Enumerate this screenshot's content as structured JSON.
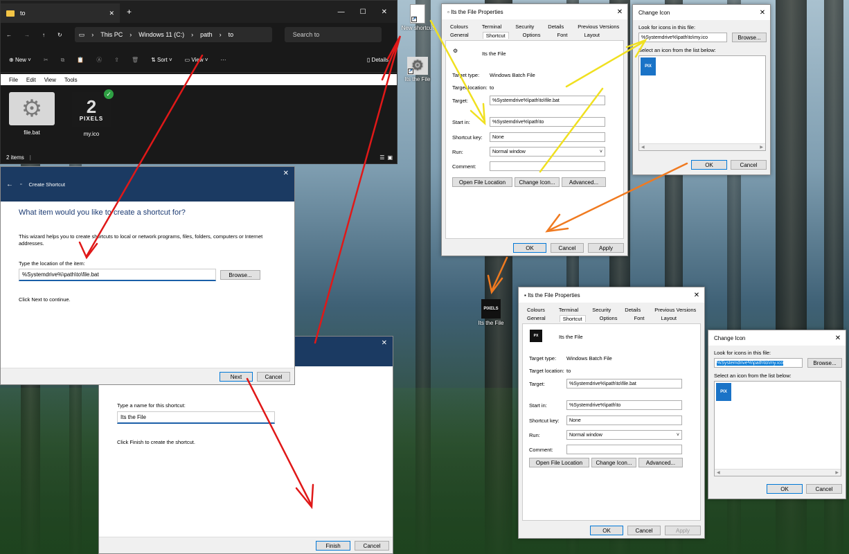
{
  "colors": {
    "red_arrow": "#e01818",
    "yellow_arrow": "#f0e020",
    "orange_arrow": "#f07a20",
    "wizard_header": "#1b3a62",
    "selection_blue": "#0078d7"
  },
  "explorer": {
    "tab_title": "to",
    "new_tab": "+",
    "breadcrumb": [
      "This PC",
      "Windows 11 (C:)",
      "path",
      "to"
    ],
    "search_placeholder": "Search to",
    "cmd_new": "New",
    "cmd_sort": "Sort",
    "cmd_view": "View",
    "cmd_details": "Details",
    "menu": [
      "File",
      "Edit",
      "View",
      "Tools"
    ],
    "files": [
      {
        "name": "file.bat",
        "icon": "gear-icon"
      },
      {
        "name": "my.ico",
        "icon": "pixels-logo-icon"
      }
    ],
    "status": "2 items"
  },
  "desktop": {
    "new_shortcut": "New shortcut",
    "its_file_1": "Its the File",
    "its_file_2": "Its the File"
  },
  "wizard1": {
    "title": "Create Shortcut",
    "heading": "What item would you like to create a shortcut for?",
    "desc": "This wizard helps you to create shortcuts to local or network programs, files, folders, computers or Internet addresses.",
    "location_label": "Type the location of the item:",
    "location_value": "%Systemdrive%\\path\\to\\file.bat",
    "browse": "Browse...",
    "continue": "Click Next to continue.",
    "next": "Next",
    "cancel": "Cancel"
  },
  "wizard2": {
    "name_label": "Type a name for this shortcut:",
    "name_value": "Its the File",
    "finish_text": "Click Finish to create the shortcut.",
    "finish": "Finish",
    "cancel": "Cancel"
  },
  "props": {
    "title": "Its the File Properties",
    "tabs_top": [
      "Colours",
      "Terminal",
      "Security",
      "Details",
      "Previous Versions"
    ],
    "tabs_bottom": [
      "General",
      "Shortcut",
      "Options",
      "Font",
      "Layout"
    ],
    "name": "Its the File",
    "target_type_label": "Target type:",
    "target_type": "Windows Batch File",
    "target_location_label": "Target location:",
    "target_location": "to",
    "target_label": "Target:",
    "target": "%Systemdrive%\\path\\to\\file.bat",
    "start_in_label": "Start in:",
    "start_in": "%Systemdrive%\\path\\to",
    "shortcut_key_label": "Shortcut key:",
    "shortcut_key": "None",
    "run_label": "Run:",
    "run": "Normal window",
    "comment_label": "Comment:",
    "open_location": "Open File Location",
    "change_icon": "Change Icon...",
    "advanced": "Advanced...",
    "ok": "OK",
    "cancel": "Cancel",
    "apply": "Apply"
  },
  "change_icon": {
    "title": "Change Icon",
    "look_label": "Look for icons in this file:",
    "look_value": "%Systemdrive%\\path\\to\\my.ico",
    "browse": "Browse...",
    "select_label": "Select an icon from the list below:",
    "ok": "OK",
    "cancel": "Cancel"
  }
}
